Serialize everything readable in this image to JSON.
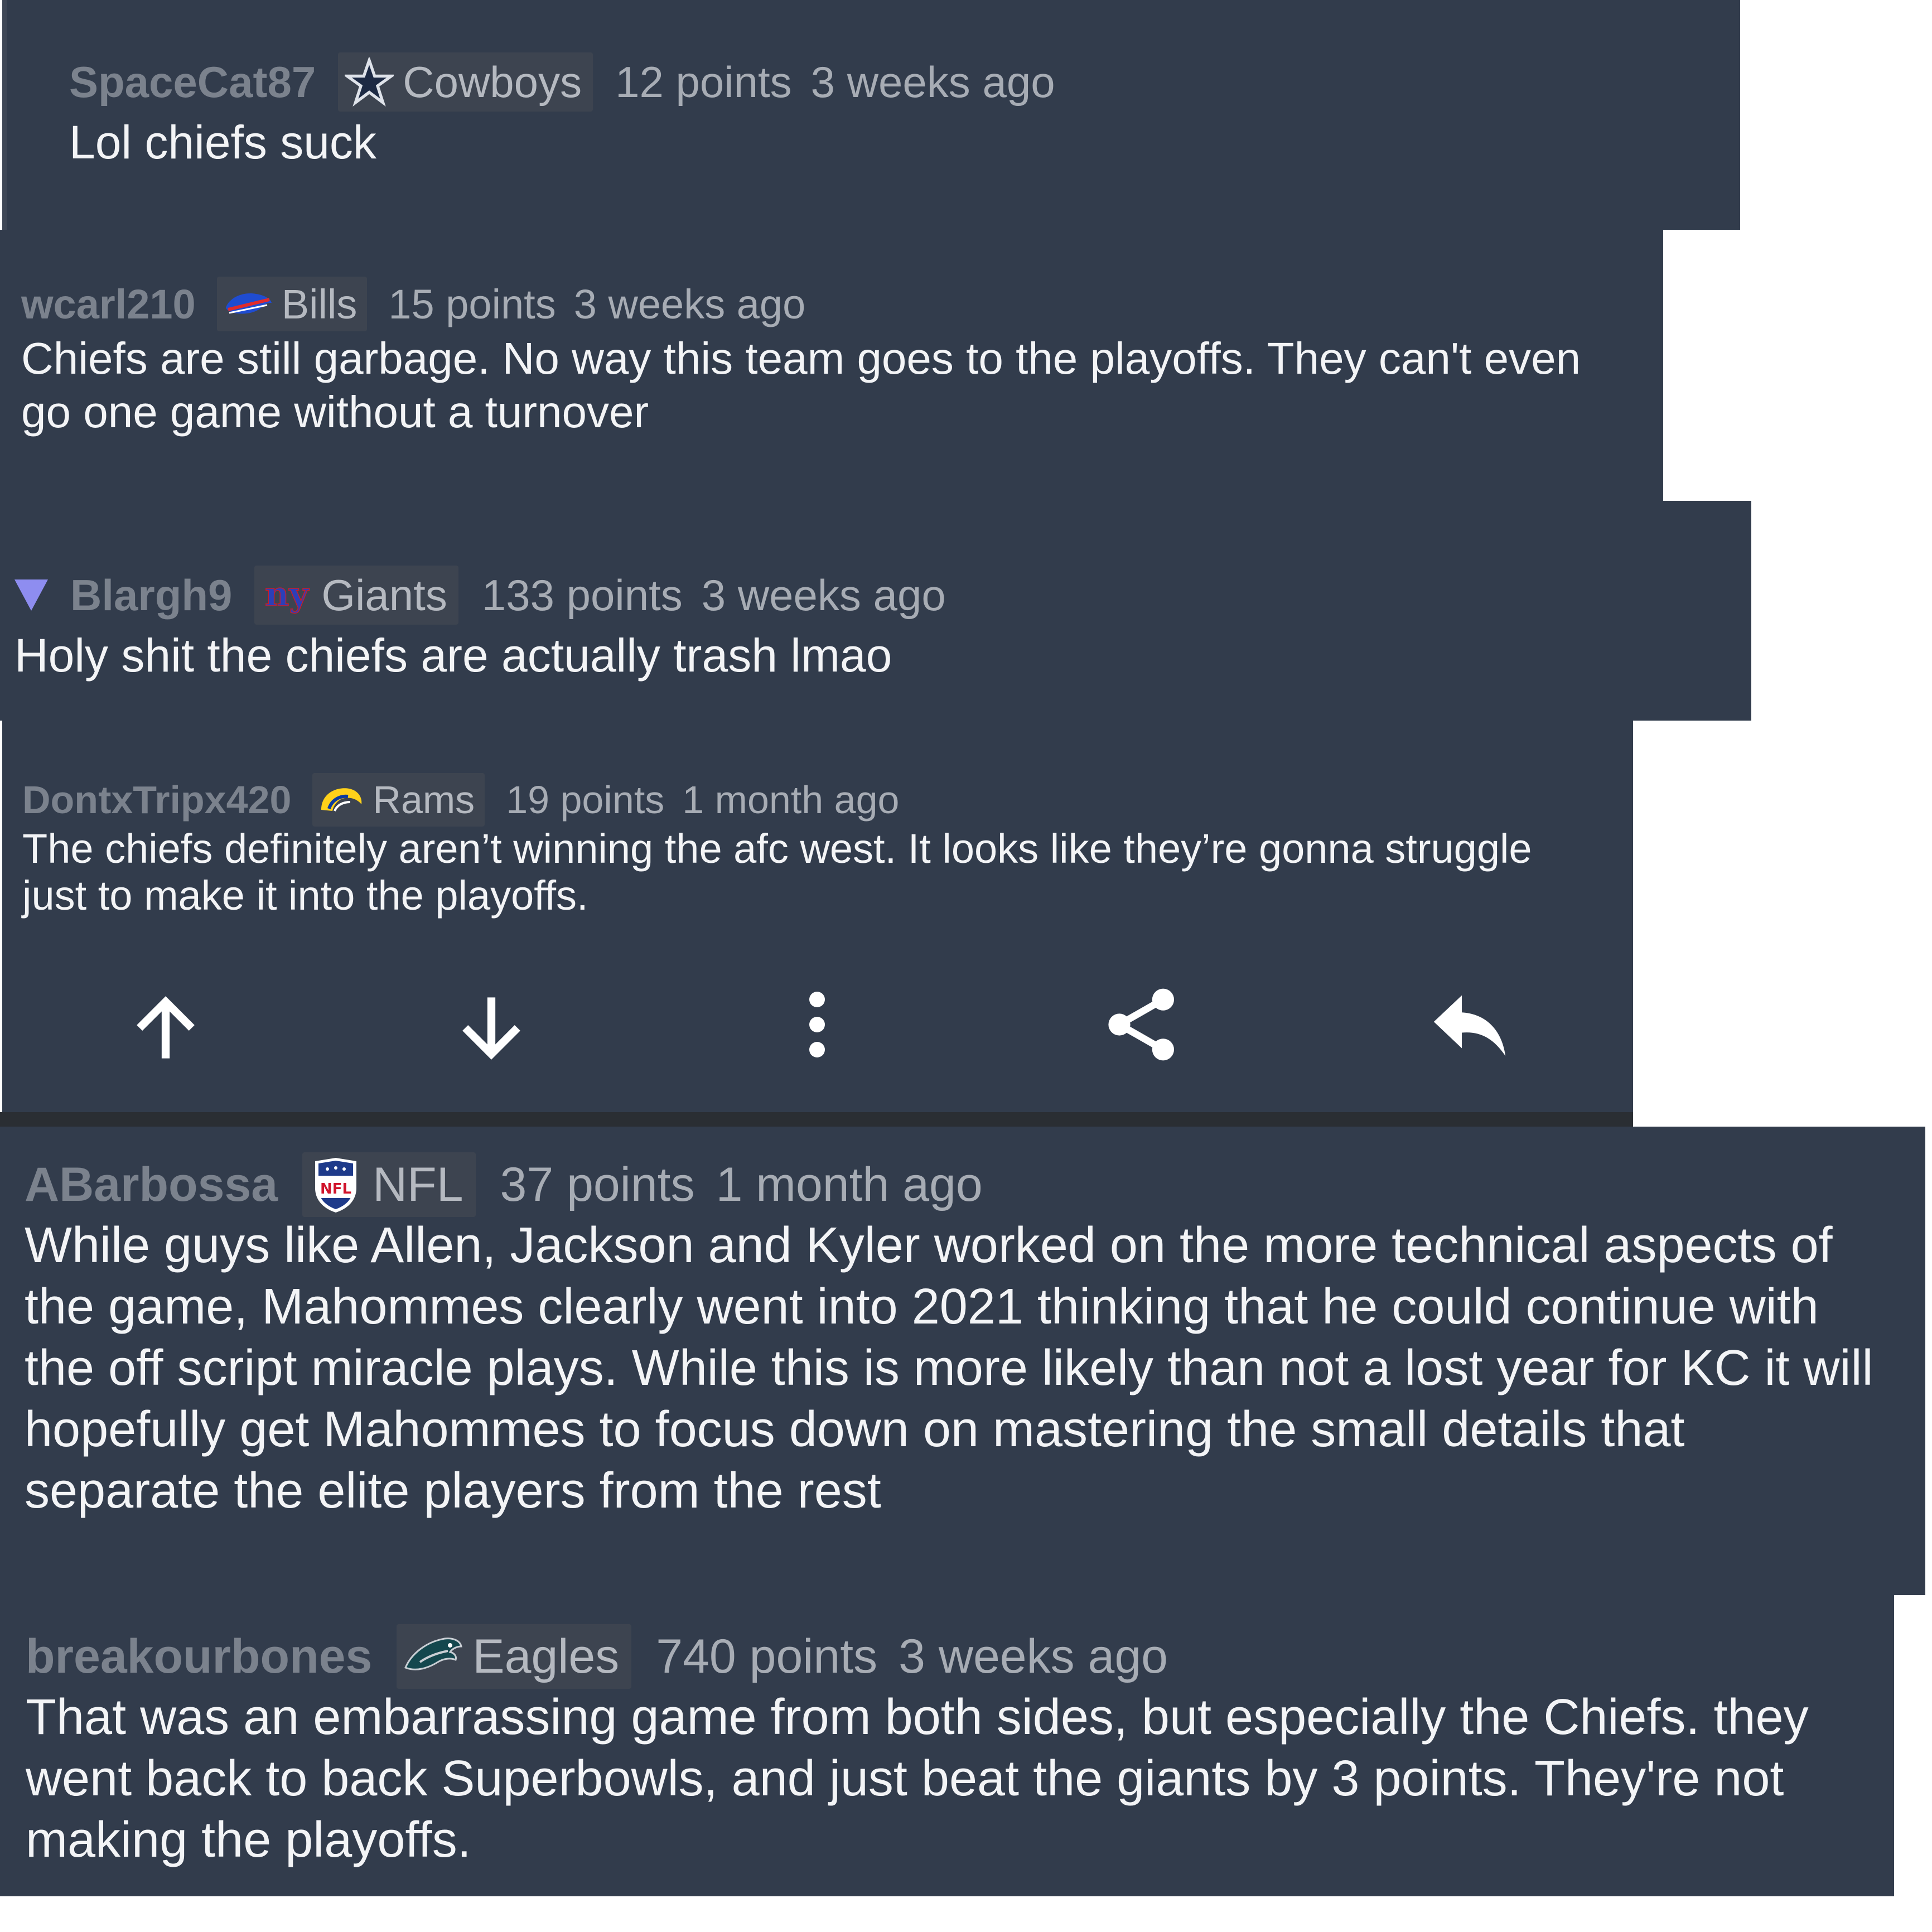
{
  "colors": {
    "card_bg": "#323c4c",
    "meta_text": "#a7acb4",
    "author_text": "#7b828d",
    "body_text": "#f3f4f6",
    "flair_bg": "#3d4450",
    "collapse_arrow": "#8e8df0"
  },
  "comments": [
    {
      "author": "SpaceCat87",
      "flair_icon": "cowboys-star-icon",
      "flair": "Cowboys",
      "points": "12 points",
      "age": "3 weeks ago",
      "body": "Lol chiefs suck"
    },
    {
      "author": "wcarl210",
      "flair_icon": "bills-buffalo-icon",
      "flair": "Bills",
      "points": "15 points",
      "age": "3 weeks ago",
      "body": "Chiefs are still garbage. No way this team goes to the playoffs. They can't even go one game without a turnover"
    },
    {
      "author": "Blargh9",
      "flair_icon": "giants-ny-icon",
      "flair": "Giants",
      "points": "133 points",
      "age": "3 weeks ago",
      "body": "Holy shit the chiefs are actually trash lmao",
      "collapse_icon": "collapse-triangle-icon"
    },
    {
      "author": "DontxTripx420",
      "flair_icon": "rams-horn-icon",
      "flair": "Rams",
      "points": "19 points",
      "age": "1 month ago",
      "body": "The chiefs definitely aren’t winning the afc west. It looks like they’re gonna struggle just to make it into the playoffs."
    },
    {
      "author": "ABarbossa",
      "flair_icon": "nfl-shield-icon",
      "flair": "NFL",
      "points": "37 points",
      "age": "1 month ago",
      "body": "While guys like Allen, Jackson and Kyler worked on the more technical aspects of the game, Mahommes clearly went into 2021 thinking that he could continue with the off script miracle plays. While this is more likely than not a lost year for KC it will hopefully get Mahommes to focus down on mastering the small details that separate the elite players from the rest"
    },
    {
      "author": "breakourbones",
      "flair_icon": "eagles-head-icon",
      "flair": "Eagles",
      "points": "740 points",
      "age": "3 weeks ago",
      "body": "That was an embarrassing game from both sides, but especially the Chiefs. they went back to back Superbowls, and just beat the giants by 3 points. They're not making the playoffs."
    }
  ],
  "actions": [
    {
      "icon": "upvote-arrow-icon"
    },
    {
      "icon": "downvote-arrow-icon"
    },
    {
      "icon": "more-options-icon"
    },
    {
      "icon": "share-icon"
    },
    {
      "icon": "reply-icon"
    }
  ]
}
